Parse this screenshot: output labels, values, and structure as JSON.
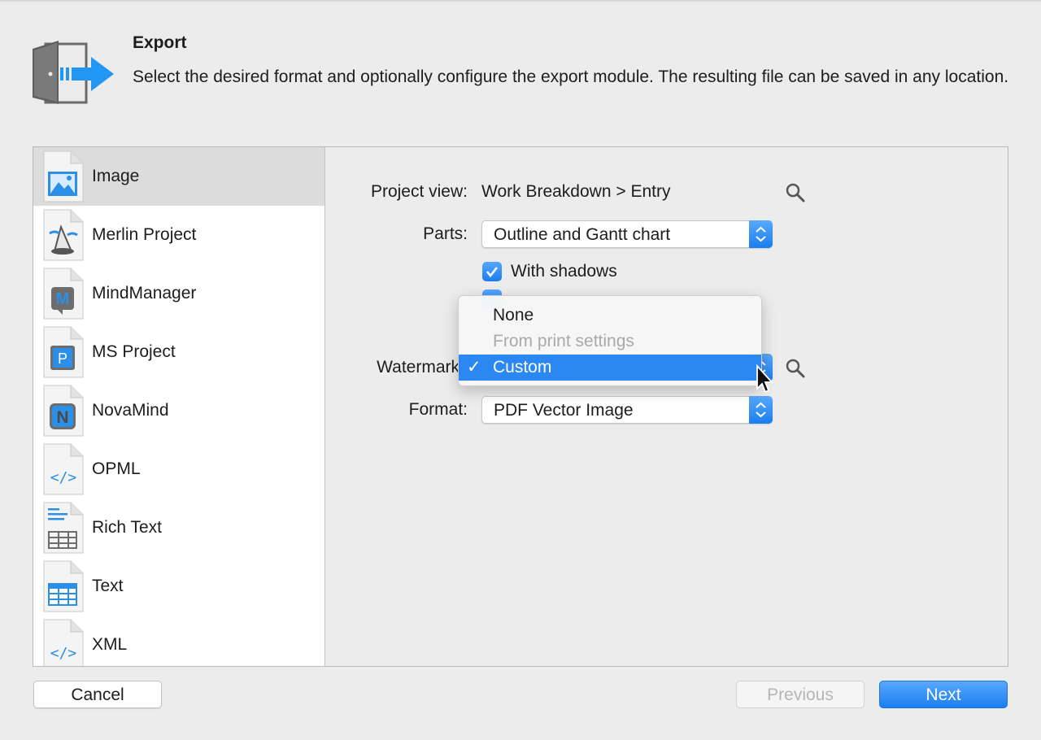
{
  "header": {
    "title": "Export",
    "description": "Select the desired format and optionally configure the export module. The resulting file can be saved in any location.",
    "icon": "export-door-icon"
  },
  "sidebar": {
    "items": [
      {
        "label": "Image",
        "icon": "image-file-icon",
        "selected": true
      },
      {
        "label": "Merlin Project",
        "icon": "merlin-project-file-icon"
      },
      {
        "label": "MindManager",
        "icon": "mindmanager-file-icon"
      },
      {
        "label": "MS Project",
        "icon": "ms-project-file-icon"
      },
      {
        "label": "NovaMind",
        "icon": "novamind-file-icon"
      },
      {
        "label": "OPML",
        "icon": "opml-file-icon"
      },
      {
        "label": "Rich Text",
        "icon": "rich-text-file-icon"
      },
      {
        "label": "Text",
        "icon": "text-file-icon"
      },
      {
        "label": "XML",
        "icon": "xml-file-icon"
      }
    ]
  },
  "form": {
    "project_view_label": "Project view:",
    "project_view_value": "Work Breakdown > Entry",
    "parts_label": "Parts:",
    "parts_value": "Outline and Gantt chart",
    "with_shadows_label": "With shadows",
    "with_shadows_checked": true,
    "watermark_label": "Watermark",
    "format_label": "Format:",
    "format_value": "PDF Vector Image"
  },
  "watermark_menu": {
    "options": [
      {
        "label": "None",
        "enabled": true
      },
      {
        "label": "From print settings",
        "enabled": false
      },
      {
        "label": "Custom",
        "selected": true,
        "check": "✓"
      }
    ]
  },
  "buttons": {
    "cancel": "Cancel",
    "previous": "Previous",
    "next": "Next"
  },
  "colors": {
    "accent": "#1a7ef0",
    "selection": "#2b87f2"
  }
}
